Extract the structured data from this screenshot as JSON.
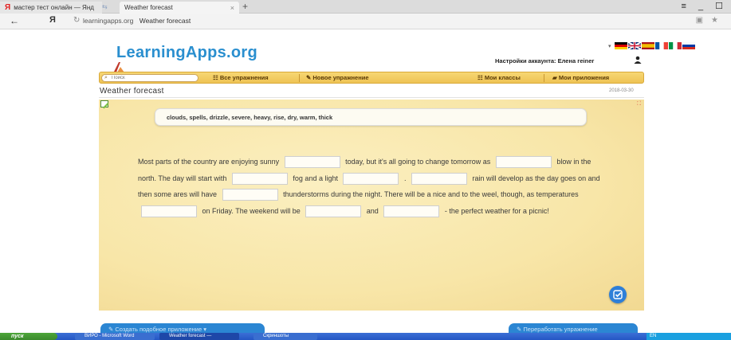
{
  "browser": {
    "tab1_label": "мастер тест онлайн — Янд",
    "tab1_logo": "Я",
    "tab2_label": "Weather forecast",
    "tab2_close": "×",
    "new_tab": "+",
    "window_controls": "≡ _ ☐",
    "back": "←",
    "yandex_button": "Я",
    "url_domain": "learningapps.org",
    "url_title": "Weather forecast"
  },
  "site": {
    "logo_text": "LearningApps.org",
    "account_text": "Настройки аккаунта: Елена геiner",
    "flags": [
      {
        "name": "de-flag",
        "colors": [
          "#000000",
          "#dd0000",
          "#ffce00"
        ]
      },
      {
        "name": "gb-flag",
        "colors": [
          "#012169",
          "#ffffff",
          "#c8102e"
        ]
      },
      {
        "name": "es-flag",
        "colors": [
          "#aa151b",
          "#f1bf00",
          "#aa151b"
        ]
      },
      {
        "name": "fr-flag",
        "colors": [
          "#0055a4",
          "#ffffff",
          "#ef4135"
        ]
      },
      {
        "name": "it-flag",
        "colors": [
          "#009246",
          "#ffffff",
          "#ce2b37"
        ]
      },
      {
        "name": "ru-flag",
        "colors": [
          "#ffffff",
          "#0039a6",
          "#d52b1e"
        ]
      }
    ],
    "search_placeholder": "Поиск",
    "nav": {
      "all_exercises": "Все упражнения",
      "new_exercise": "Новое упражнение",
      "my_classes": "Мои классы",
      "my_apps": "Мои приложения"
    },
    "exercise_title": "Weather forecast",
    "date": "2018-03-30",
    "create_similar": "Создать подобное приложение",
    "rework": "Переработать упражнение"
  },
  "exercise": {
    "word_bank": "clouds, spells, drizzle, severe, heavy, rise, dry, warm, thick",
    "segments": [
      "Most parts of the country are enjoying sunny",
      "today, but it's all going to change tomorrow as",
      "blow in the north. The day will start with",
      "fog and a light",
      ".",
      "rain will develop as the day goes on and then some ares will have",
      "thunderstorms during the night. There will be a nice and to the weel, though, as temperatures",
      "on Friday. The weekend will be",
      "and",
      "- the perfect weather for a picnic!"
    ],
    "blank_values": [
      "",
      "",
      "",
      "",
      "",
      "",
      "",
      "",
      ""
    ]
  },
  "taskbar": {
    "start": "пуск",
    "items": [
      "ВИРО - Microsoft Word",
      "Weather forecast —",
      "Скриншоты"
    ],
    "tray": "EN"
  },
  "colors": {
    "logo_blue": "#2a8fcf",
    "nav_gold": "#eec354",
    "exercise_bg": "#f8e6a8",
    "button_blue": "#2b86d3"
  }
}
